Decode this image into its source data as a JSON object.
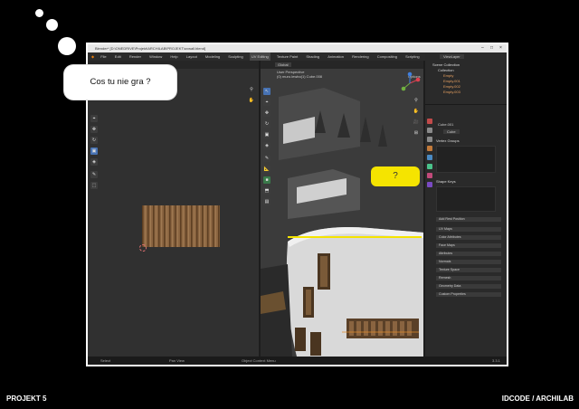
{
  "slide": {
    "bubble_text": "Cos tu nie gra ?",
    "question_mark": "?",
    "footer_left": "PROJEKT 5",
    "footer_right": "IDCODE / ARCHILAB"
  },
  "blender": {
    "title": "Blender* [D:\\ONEDRIVE\\Projekt\\ARCHILAB\\PROJEKT\\uvwall.blend]",
    "window_controls": [
      "–",
      "□",
      "×"
    ],
    "menu": [
      "File",
      "Edit",
      "Render",
      "Window",
      "Help"
    ],
    "workspaces": [
      "Layout",
      "Modeling",
      "Sculpting",
      "UV Editing",
      "Texture Paint",
      "Shading",
      "Animation",
      "Rendering",
      "Compositing",
      "Scripting"
    ],
    "active_workspace": "UV Editing",
    "scene": "Scene",
    "view_layer": "ViewLayer",
    "viewport": {
      "header_orientation": "Global",
      "perspective": "User Perspective",
      "object_info": "(0) muro.lewbo(1) Cube.008",
      "options": "Options"
    },
    "outliner": {
      "collection_root": "Scene Collection",
      "items": [
        "Collection",
        "Empty",
        "Empty.001",
        "Empty.002",
        "Empty.003"
      ]
    },
    "properties": {
      "object_name": "Cube.001",
      "mesh_name": "Cube",
      "sections": [
        "Vertex Groups",
        "Shape Keys"
      ],
      "rows": [
        "Add Rest Position",
        "UV Maps",
        "Color Attributes",
        "Face Maps",
        "Attributes",
        "Normals",
        "Texture Space",
        "Remesh",
        "Geometry Data",
        "Custom Properties"
      ]
    },
    "status": {
      "left": "Select",
      "middle": "Pan View",
      "right": "Object Context Menu",
      "version": "3.3.1"
    }
  }
}
